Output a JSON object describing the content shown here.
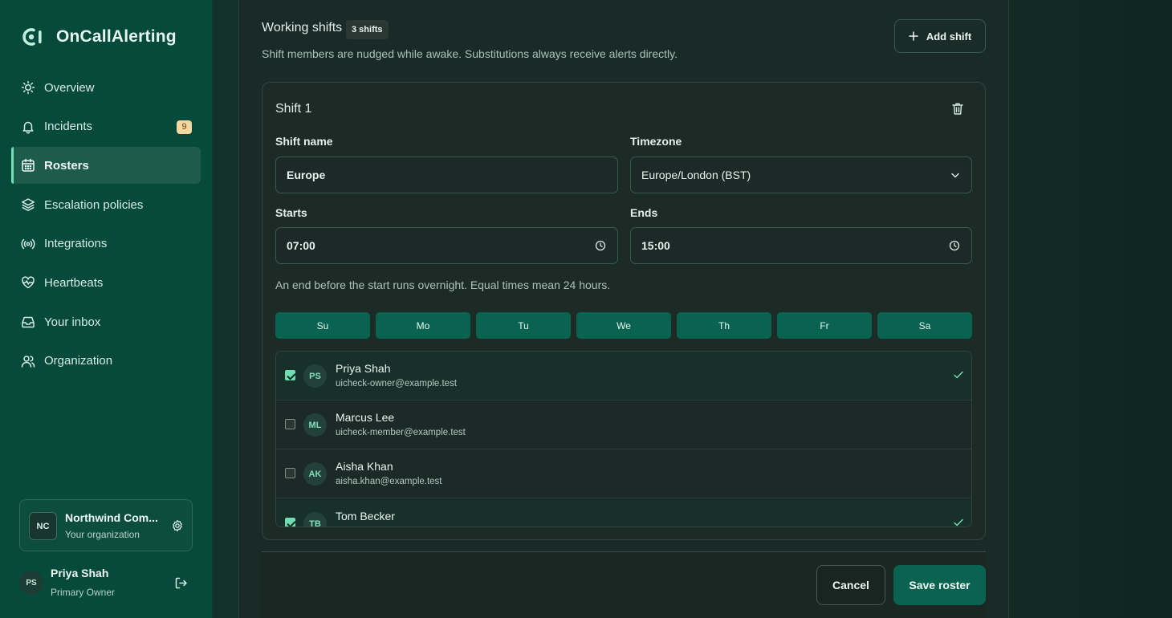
{
  "app": {
    "name": "OnCallAlerting"
  },
  "sidebar": {
    "items": [
      {
        "label": "Overview",
        "icon": "sun-icon"
      },
      {
        "label": "Incidents",
        "icon": "bell-icon",
        "badge": "9"
      },
      {
        "label": "Rosters",
        "icon": "calendar-icon",
        "active": true
      },
      {
        "label": "Escalation policies",
        "icon": "layers-icon"
      },
      {
        "label": "Integrations",
        "icon": "broadcast-icon"
      },
      {
        "label": "Heartbeats",
        "icon": "heart-pulse-icon"
      },
      {
        "label": "Your inbox",
        "icon": "inbox-icon"
      },
      {
        "label": "Organization",
        "icon": "users-icon"
      }
    ],
    "org": {
      "initials": "NC",
      "name": "Northwind Com...",
      "subtitle": "Your organization"
    },
    "user": {
      "initials": "PS",
      "name": "Priya Shah",
      "role": "Primary Owner"
    }
  },
  "shifts_section": {
    "title": "Working shifts",
    "count": "3 shifts",
    "description": "Shift members are nudged while awake. Substitutions always receive alerts directly.",
    "add_label": "Add shift"
  },
  "shift": {
    "title": "Shift 1",
    "name_label": "Shift name",
    "name_value": "Europe",
    "timezone_label": "Timezone",
    "timezone_value": "Europe/London (BST)",
    "starts_label": "Starts",
    "starts_value": "07:00",
    "ends_label": "Ends",
    "ends_value": "15:00",
    "hint": "An end before the start runs overnight. Equal times mean 24 hours.",
    "days": [
      "Su",
      "Mo",
      "Tu",
      "We",
      "Th",
      "Fr",
      "Sa"
    ],
    "members": [
      {
        "initials": "PS",
        "name": "Priya Shah",
        "email": "uicheck-owner@example.test",
        "selected": true
      },
      {
        "initials": "ML",
        "name": "Marcus Lee",
        "email": "uicheck-member@example.test",
        "selected": false
      },
      {
        "initials": "AK",
        "name": "Aisha Khan",
        "email": "aisha.khan@example.test",
        "selected": false
      },
      {
        "initials": "TB",
        "name": "Tom Becker",
        "email": "",
        "selected": true
      }
    ]
  },
  "footer": {
    "cancel_label": "Cancel",
    "save_label": "Save roster"
  },
  "colors": {
    "sidebar": "#054a3a",
    "accent": "#0a6350",
    "highlight": "#6fdcb3",
    "badge": "#f3d9a0"
  }
}
